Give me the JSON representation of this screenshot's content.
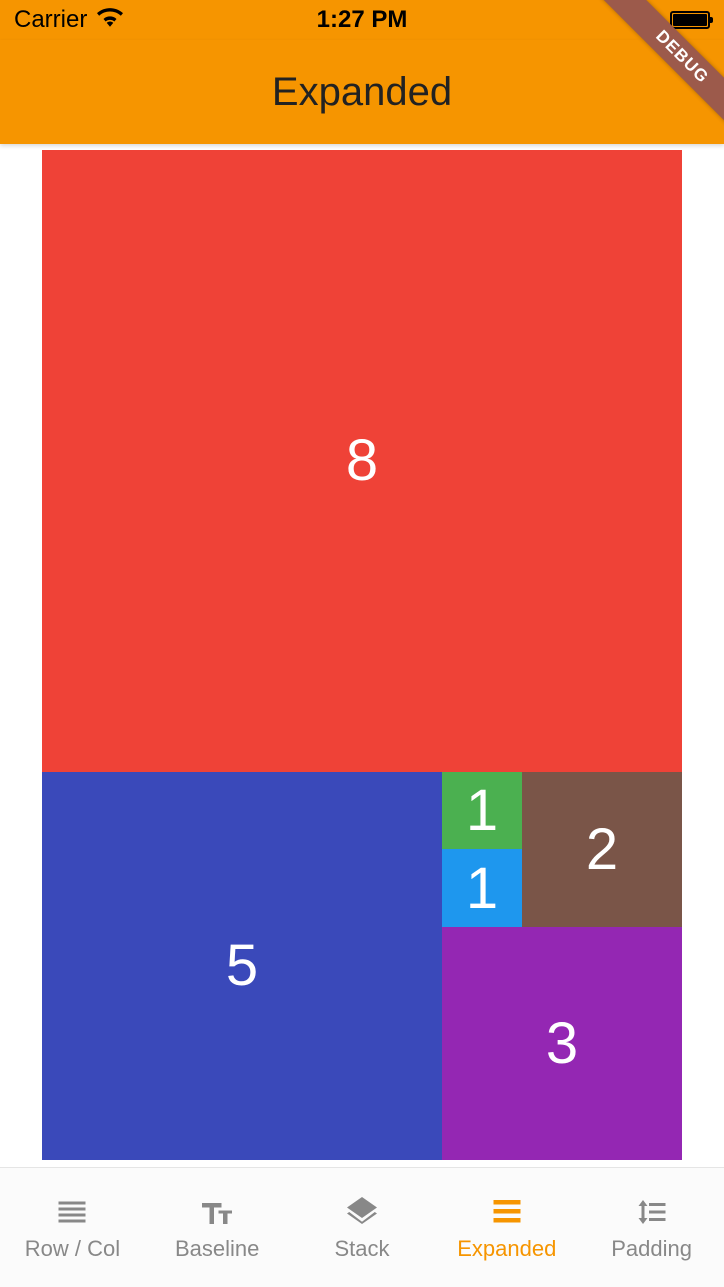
{
  "status": {
    "carrier": "Carrier",
    "time": "1:27 PM"
  },
  "debug_banner": "DEBUG",
  "appbar": {
    "title": "Expanded"
  },
  "tiles": {
    "t8": {
      "label": "8",
      "color": "#EF4237"
    },
    "t5": {
      "label": "5",
      "color": "#3A49BA"
    },
    "t3": {
      "label": "3",
      "color": "#9427B3"
    },
    "t2": {
      "label": "2",
      "color": "#7A5548"
    },
    "t1a": {
      "label": "1",
      "color": "#4BB050"
    },
    "t1b": {
      "label": "1",
      "color": "#1E97EE"
    }
  },
  "nav": {
    "active_index": 3,
    "items": [
      {
        "label": "Row / Col"
      },
      {
        "label": "Baseline"
      },
      {
        "label": "Stack"
      },
      {
        "label": "Expanded"
      },
      {
        "label": "Padding"
      }
    ]
  }
}
